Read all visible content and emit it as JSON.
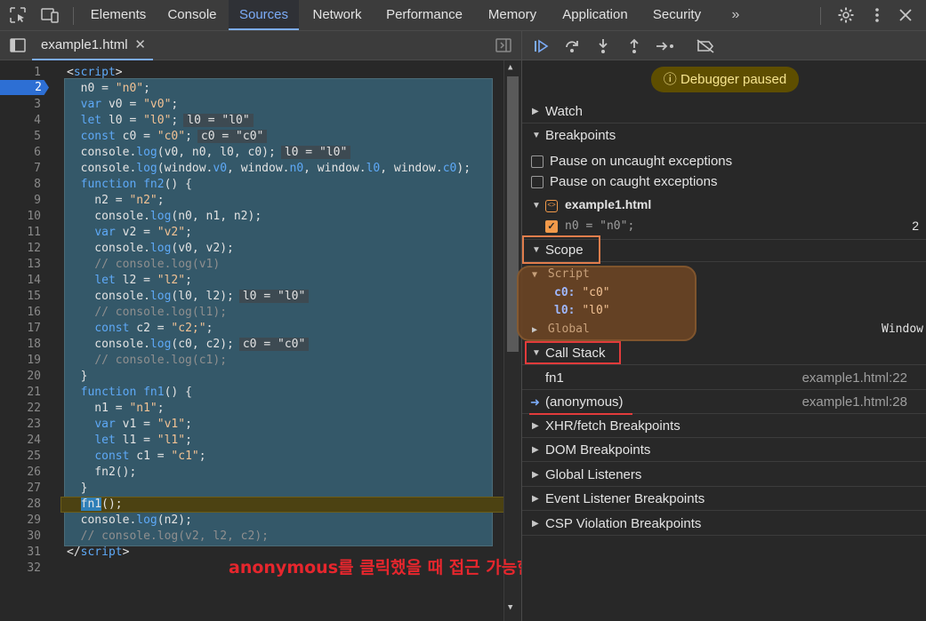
{
  "topbar": {
    "tabs": [
      "Elements",
      "Console",
      "Sources",
      "Network",
      "Performance",
      "Memory",
      "Application",
      "Security"
    ],
    "active_tab": "Sources",
    "more": "»"
  },
  "editor": {
    "file_tab": "example1.html",
    "line_numbers": [
      "1",
      "2",
      "3",
      "4",
      "5",
      "6",
      "7",
      "8",
      "9",
      "10",
      "11",
      "12",
      "13",
      "14",
      "15",
      "16",
      "17",
      "18",
      "19",
      "20",
      "21",
      "22",
      "23",
      "24",
      "25",
      "26",
      "27",
      "28",
      "29",
      "30",
      "31",
      "32"
    ],
    "breakpoint_line": "2",
    "current_line": "28"
  },
  "debugger": {
    "status": "Debugger paused",
    "watch": "Watch",
    "breakpoints": "Breakpoints",
    "pause_uncaught": "Pause on uncaught exceptions",
    "pause_caught": "Pause on caught exceptions",
    "bp_file": "example1.html",
    "bp_code": "n0 = \"n0\";",
    "bp_line": "2",
    "scope": "Scope",
    "script": "Script",
    "script_vars": [
      {
        "name": "c0",
        "value": "\"c0\""
      },
      {
        "name": "l0",
        "value": "\"l0\""
      }
    ],
    "global": "Global",
    "global_value": "Window",
    "call_stack": "Call Stack",
    "frames": [
      {
        "name": "fn1",
        "location": "example1.html:22"
      },
      {
        "name": "(anonymous)",
        "location": "example1.html:28"
      }
    ],
    "xhr": "XHR/fetch Breakpoints",
    "dom": "DOM Breakpoints",
    "global_listeners": "Global Listeners",
    "event_listener": "Event Listener Breakpoints",
    "csp": "CSP Violation Breakpoints"
  },
  "annotation": "anonymous를 클릭했을 때 접근 가능한영역",
  "colors": {
    "accent": "#7cacf8",
    "paused_bg": "#5e4e00",
    "annotation_red": "#e6262d"
  }
}
